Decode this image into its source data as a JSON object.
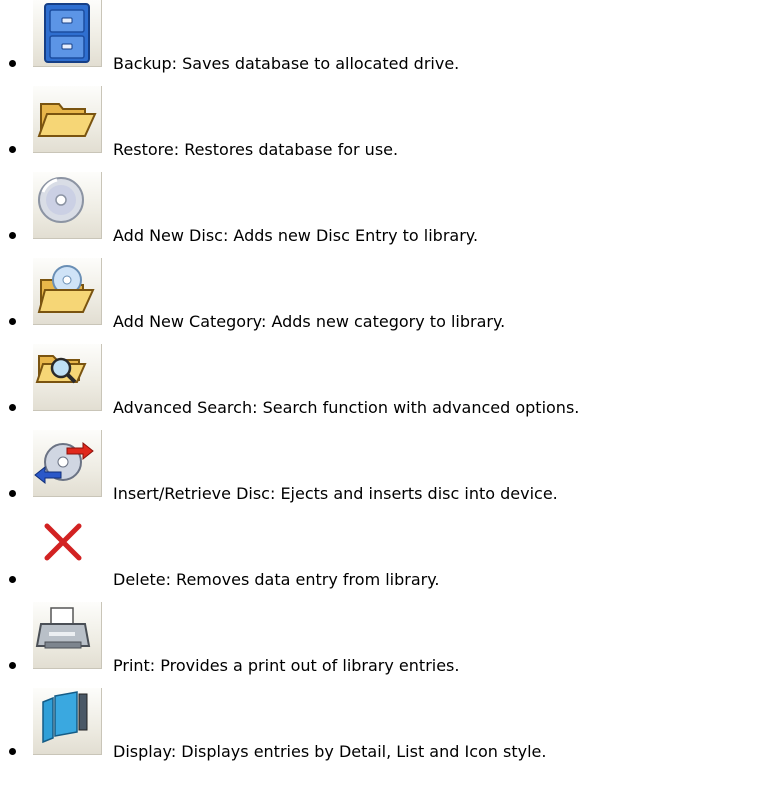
{
  "items": [
    {
      "icon": "filing-cabinet-icon",
      "text": "Backup: Saves database to allocated drive."
    },
    {
      "icon": "open-folder-icon",
      "text": "Restore: Restores database for use."
    },
    {
      "icon": "disc-icon",
      "text": "Add New Disc: Adds new Disc Entry to library."
    },
    {
      "icon": "folder-with-disc-icon",
      "text": "Add New Category: Adds new category to library."
    },
    {
      "icon": "folder-search-icon",
      "text": "Advanced Search: Search function with advanced options."
    },
    {
      "icon": "disc-arrows-icon",
      "text": "Insert/Retrieve Disc: Ejects and inserts disc into device."
    },
    {
      "icon": "red-x-icon",
      "text": "Delete: Removes data entry from library."
    },
    {
      "icon": "printer-icon",
      "text": "Print: Provides a print out of library entries."
    },
    {
      "icon": "display-view-icon",
      "text": "Display: Displays entries by Detail, List and Icon style."
    }
  ]
}
